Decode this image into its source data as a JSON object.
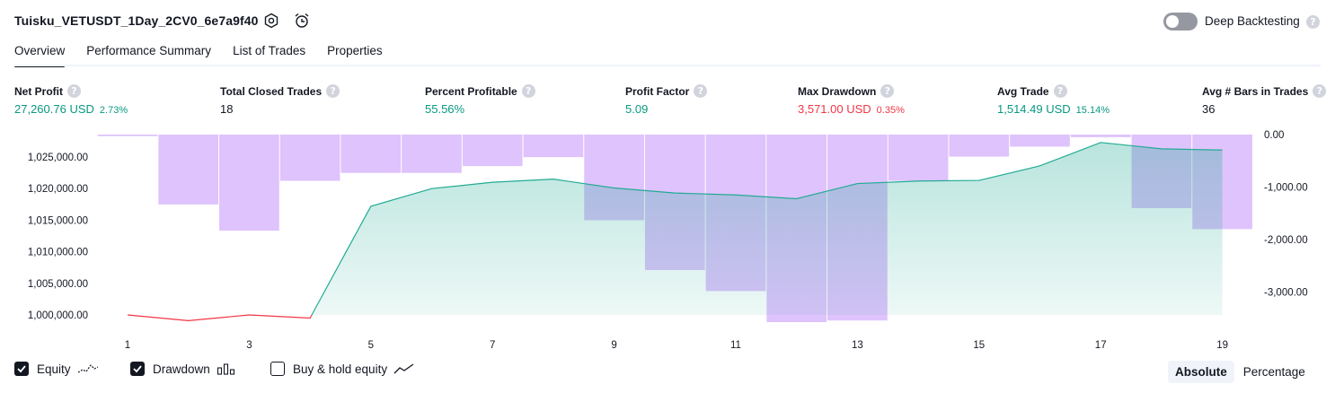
{
  "header": {
    "title": "Tuisku_VETUSDT_1Day_2CV0_6e7a9f40",
    "deep_backtesting_label": "Deep Backtesting",
    "help_glyph": "?"
  },
  "tabs": [
    {
      "label": "Overview",
      "active": true
    },
    {
      "label": "Performance Summary",
      "active": false
    },
    {
      "label": "List of Trades",
      "active": false
    },
    {
      "label": "Properties",
      "active": false
    }
  ],
  "metrics": [
    {
      "label": "Net Profit",
      "value": "27,260.76 USD",
      "pct": "2.73%",
      "color": "#089981"
    },
    {
      "label": "Total Closed Trades",
      "value": "18",
      "pct": "",
      "color": "#131722"
    },
    {
      "label": "Percent Profitable",
      "value": "55.56%",
      "pct": "",
      "color": "#089981"
    },
    {
      "label": "Profit Factor",
      "value": "5.09",
      "pct": "",
      "color": "#089981"
    },
    {
      "label": "Max Drawdown",
      "value": "3,571.00 USD",
      "pct": "0.35%",
      "color": "#f23645"
    },
    {
      "label": "Avg Trade",
      "value": "1,514.49 USD",
      "pct": "15.14%",
      "color": "#089981"
    },
    {
      "label": "Avg # Bars in Trades",
      "value": "36",
      "pct": "",
      "color": "#131722"
    }
  ],
  "chart_data": {
    "type": "area",
    "x": [
      1,
      2,
      3,
      4,
      5,
      6,
      7,
      8,
      9,
      10,
      11,
      12,
      13,
      14,
      15,
      16,
      17,
      18,
      19
    ],
    "x_tick_labels": [
      "1",
      "3",
      "5",
      "7",
      "9",
      "11",
      "13",
      "15",
      "17",
      "19"
    ],
    "left_axis": {
      "tick_labels": [
        "1,025,000.00",
        "1,020,000.00",
        "1,015,000.00",
        "1,010,000.00",
        "1,005,000.00",
        "1,000,000.00"
      ],
      "ylim": [
        999000,
        1028500
      ]
    },
    "right_axis": {
      "tick_labels": [
        "0.00",
        "-1,000.00",
        "-2,000.00",
        "-3,000.00"
      ],
      "ylim": [
        -3571,
        0
      ]
    },
    "series": [
      {
        "name": "Equity",
        "values": [
          1000000,
          999100,
          1000000,
          999500,
          1017200,
          1020000,
          1021000,
          1021500,
          1020100,
          1019300,
          1019000,
          1018400,
          1020800,
          1021200,
          1021300,
          1023600,
          1027300,
          1026300,
          1026100
        ]
      },
      {
        "name": "Drawdown",
        "values": [
          -30,
          -1330,
          -1830,
          -880,
          -730,
          -730,
          -600,
          -430,
          -1630,
          -2580,
          -2980,
          -3571,
          -3540,
          -880,
          -420,
          -230,
          -50,
          -1400,
          -1800
        ]
      }
    ],
    "colors": {
      "equity_line": "#22ab94",
      "negative_line": "#f23645",
      "drawdown_bar": "#d9b8fb"
    }
  },
  "legend": {
    "equity_label": "Equity",
    "drawdown_label": "Drawdown",
    "buy_hold_label": "Buy & hold equity",
    "equity_checked": true,
    "drawdown_checked": true,
    "buy_hold_checked": false
  },
  "view_toggle": {
    "absolute_label": "Absolute",
    "percentage_label": "Percentage",
    "selected": "Absolute"
  }
}
